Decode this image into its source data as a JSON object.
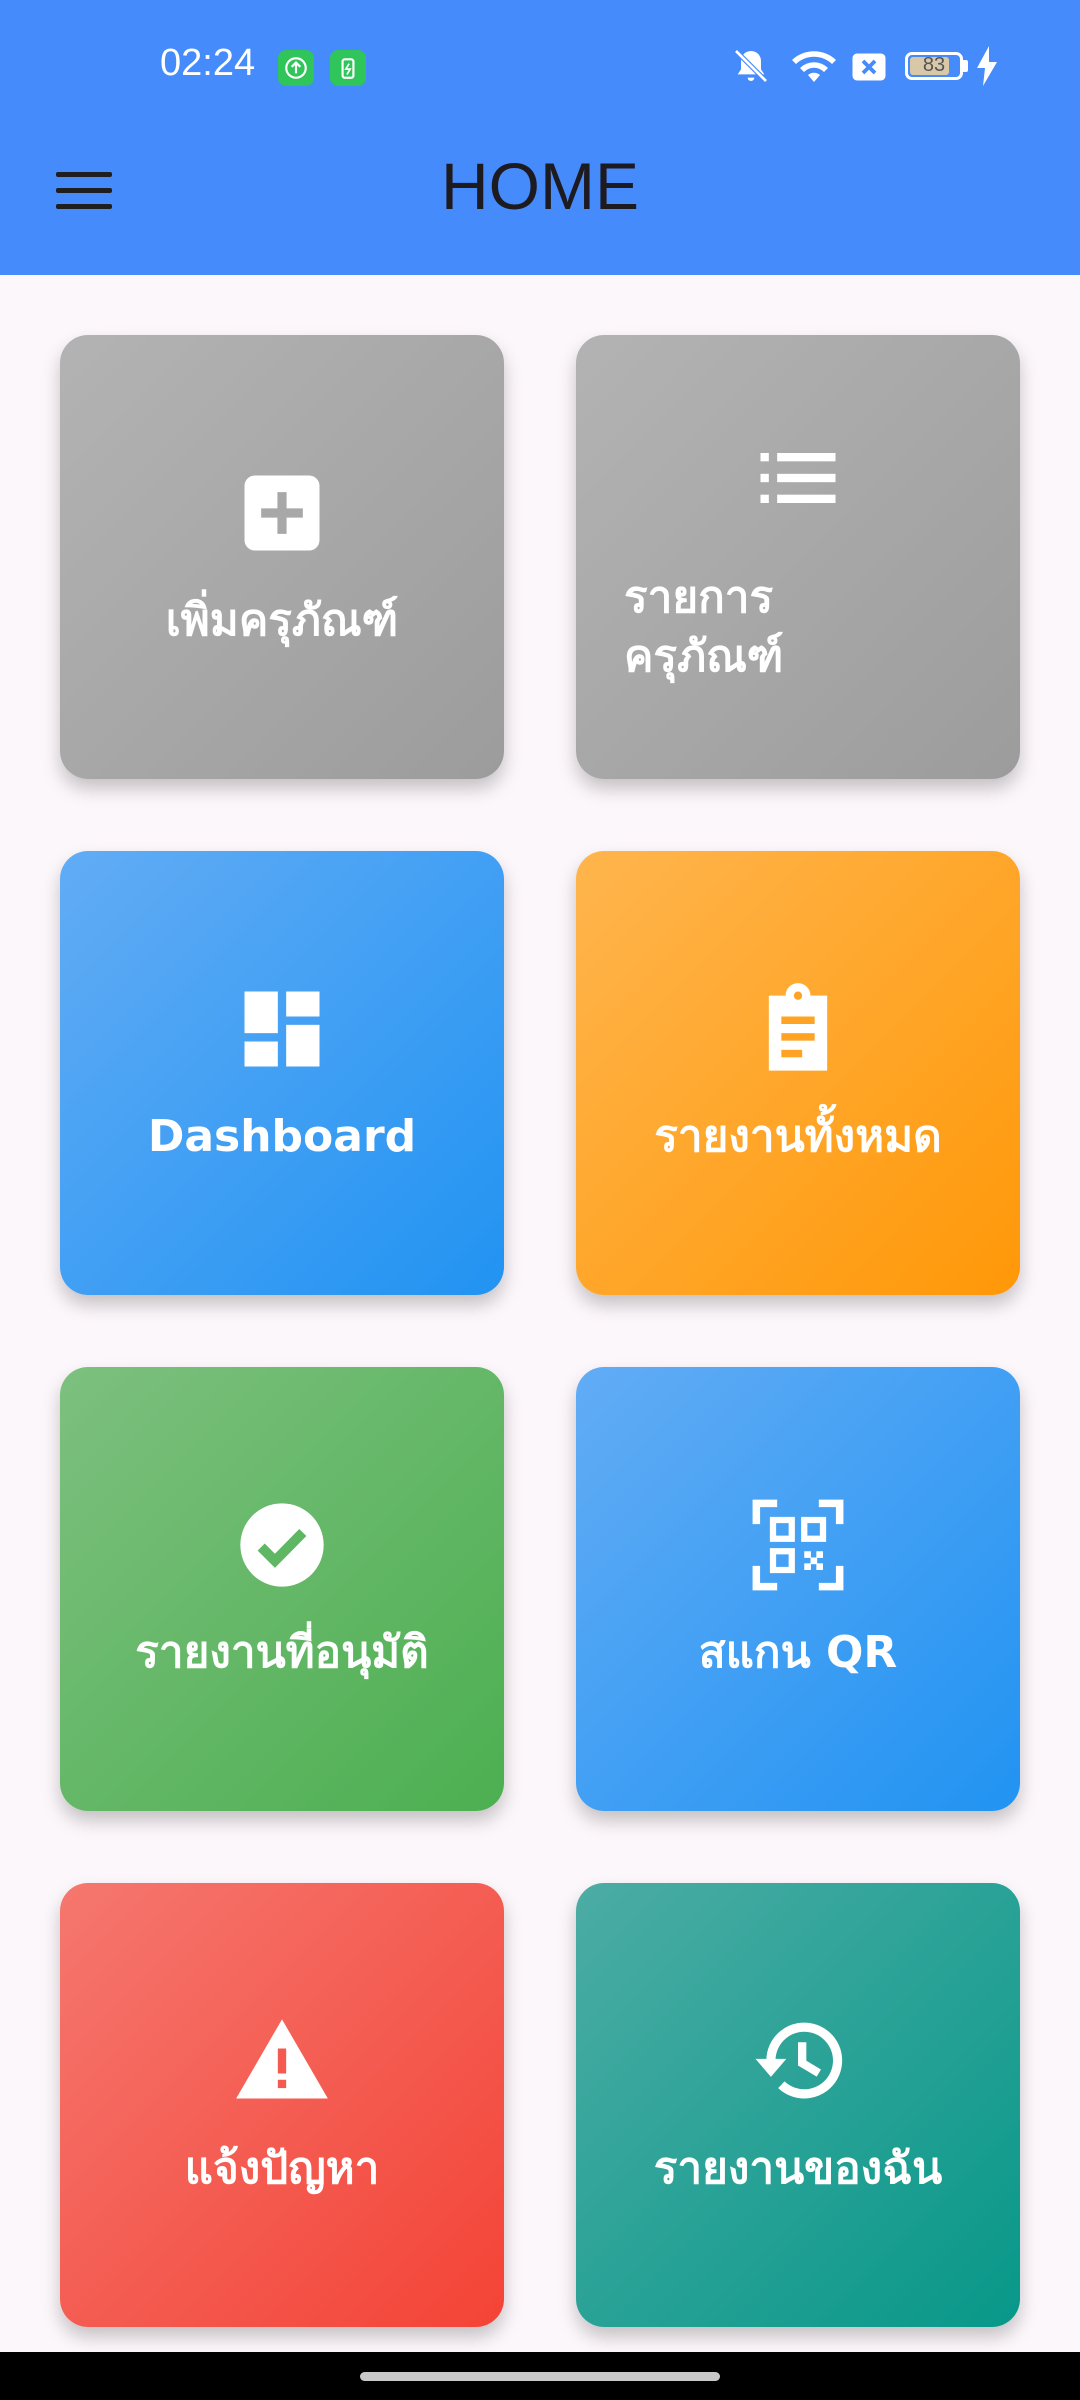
{
  "status": {
    "time": "02:24",
    "battery": "83",
    "battery_level": 0.83
  },
  "header": {
    "title": "HOME",
    "menu_icon": "menu-icon"
  },
  "tiles": [
    {
      "label": "เพิ่มครุภัณฑ์",
      "icon": "add-box-icon",
      "color": "#a8a8a8"
    },
    {
      "label": "รายการ\nครุภัณฑ์",
      "icon": "list-icon",
      "color": "#a8a8a8"
    },
    {
      "label": "Dashboard",
      "icon": "dashboard-icon",
      "color": "#2f9af4"
    },
    {
      "label": "รายงานทั้งหมด",
      "icon": "clipboard-icon",
      "color": "#ffa325"
    },
    {
      "label": "รายงานที่อนุมัติ",
      "icon": "check-circle-icon",
      "color": "#5fb763"
    },
    {
      "label": "สแกน QR",
      "icon": "qr-scan-icon",
      "color": "#2f9af4"
    },
    {
      "label": "แจ้งปัญหา",
      "icon": "warning-icon",
      "color": "#f45a50"
    },
    {
      "label": "รายงานของฉัน",
      "icon": "history-icon",
      "color": "#1fa095"
    }
  ]
}
